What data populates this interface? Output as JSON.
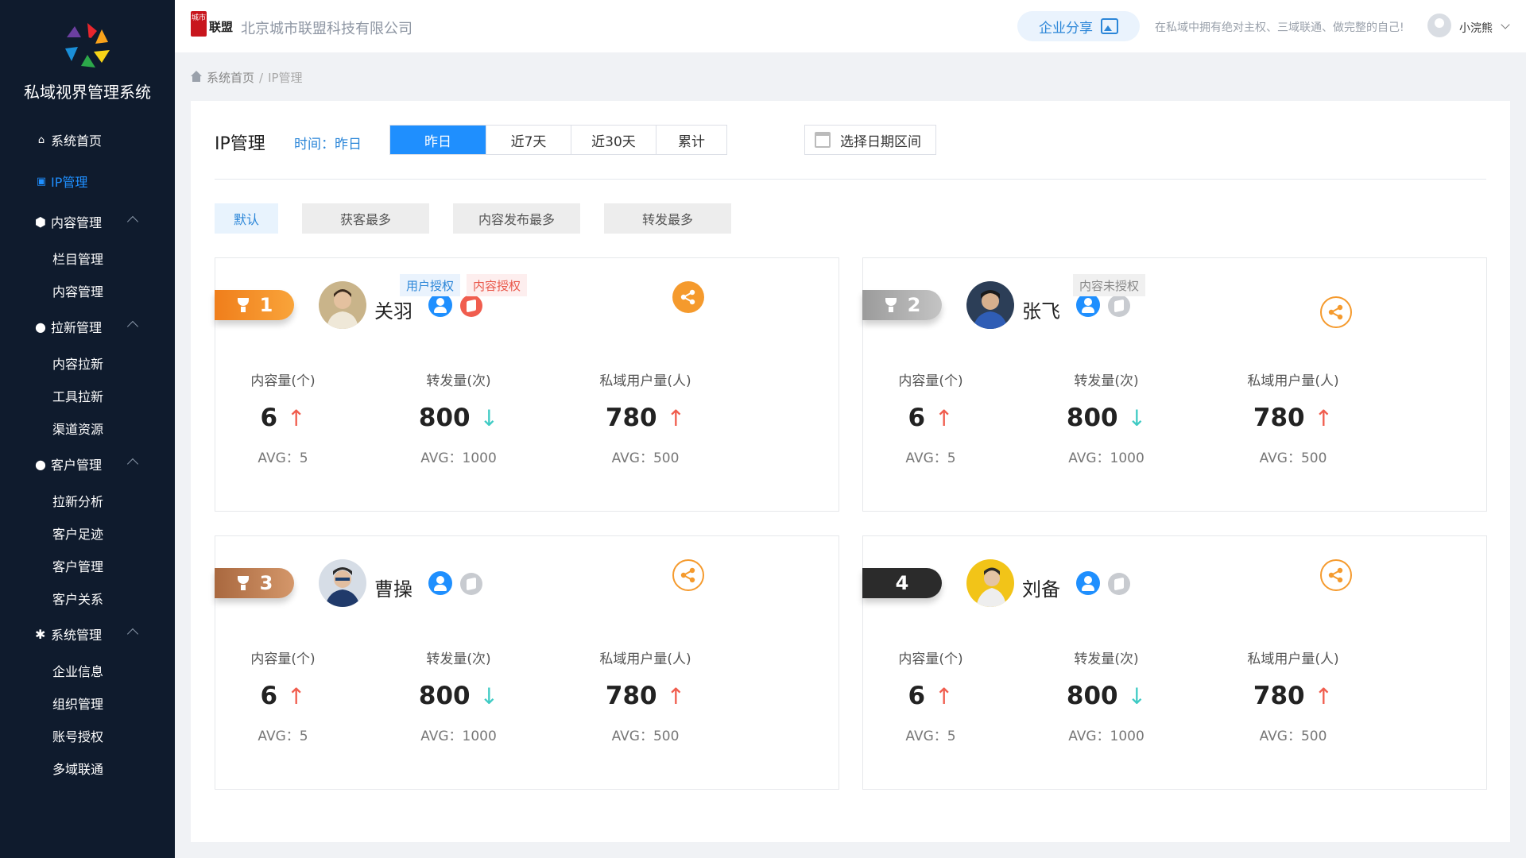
{
  "sidebar": {
    "title": "私域视界管理系统",
    "home": "系统首页",
    "ip": "IP管理",
    "groups": [
      {
        "label": "内容管理",
        "icon": "cube-icon",
        "items": [
          "栏目管理",
          "内容管理"
        ]
      },
      {
        "label": "拉新管理",
        "icon": "user-icon",
        "items": [
          "内容拉新",
          "工具拉新",
          "渠道资源"
        ]
      },
      {
        "label": "客户管理",
        "icon": "customer-icon",
        "items": [
          "拉新分析",
          "客户足迹",
          "客户管理",
          "客户关系"
        ]
      },
      {
        "label": "系统管理",
        "icon": "gear-icon",
        "items": [
          "企业信息",
          "组织管理",
          "账号授权",
          "多域联通"
        ]
      }
    ]
  },
  "header": {
    "brand_badge": "城市",
    "brand": "联盟",
    "company": "北京城市联盟科技有限公司",
    "share": "企业分享",
    "slogan": "在私域中拥有绝对主权、三域联通、做完整的自己!",
    "username": "小浣熊"
  },
  "breadcrumb": {
    "home": "系统首页",
    "sep": "/",
    "current": "IP管理"
  },
  "main": {
    "title": "IP管理",
    "time_label": "时间：昨日",
    "tabs": [
      "昨日",
      "近7天",
      "近30天",
      "累计"
    ],
    "date_range": "选择日期区间",
    "filters": [
      "默认",
      "获客最多",
      "内容发布最多",
      "转发最多"
    ],
    "tags": {
      "user_auth": "用户授权",
      "content_auth": "内容授权",
      "content_unauth": "内容未授权"
    },
    "metric_labels": [
      "内容量(个)",
      "转发量(次)",
      "私域用户量(人)"
    ],
    "cards": [
      {
        "rank": "1",
        "name": "关羽",
        "metrics": [
          {
            "value": "6",
            "avg": "AVG：5",
            "trend": "up"
          },
          {
            "value": "800",
            "avg": "AVG：1000",
            "trend": "down"
          },
          {
            "value": "780",
            "avg": "AVG：500",
            "trend": "up"
          }
        ]
      },
      {
        "rank": "2",
        "name": "张飞",
        "metrics": [
          {
            "value": "6",
            "avg": "AVG：5",
            "trend": "up"
          },
          {
            "value": "800",
            "avg": "AVG：1000",
            "trend": "down"
          },
          {
            "value": "780",
            "avg": "AVG：500",
            "trend": "up"
          }
        ]
      },
      {
        "rank": "3",
        "name": "曹操",
        "metrics": [
          {
            "value": "6",
            "avg": "AVG：5",
            "trend": "up"
          },
          {
            "value": "800",
            "avg": "AVG：1000",
            "trend": "down"
          },
          {
            "value": "780",
            "avg": "AVG：500",
            "trend": "up"
          }
        ]
      },
      {
        "rank": "4",
        "name": "刘备",
        "metrics": [
          {
            "value": "6",
            "avg": "AVG：5",
            "trend": "up"
          },
          {
            "value": "800",
            "avg": "AVG：1000",
            "trend": "down"
          },
          {
            "value": "780",
            "avg": "AVG：500",
            "trend": "up"
          }
        ]
      }
    ],
    "arrows": {
      "up": "↑",
      "down": "↓"
    }
  },
  "colors": {
    "accent": "#1f8ffe",
    "sidebar_bg": "#0f1b2d",
    "share_orange": "#f59a2d",
    "up": "#f05d4e",
    "down": "#3fcbc4"
  }
}
